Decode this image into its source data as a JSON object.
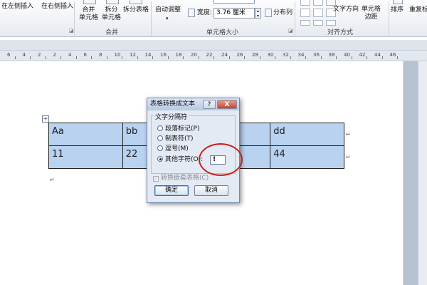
{
  "ribbon": {
    "insert_left": "在左侧插入",
    "insert_right": "在右侧插入",
    "merge_cells": [
      "合并",
      "单元格"
    ],
    "split_cells": [
      "拆分",
      "单元格"
    ],
    "split_table": "拆分表格",
    "auto_fit": "自动调整",
    "width_label": "宽度:",
    "width_value": "3.76 厘米",
    "distribute_columns": "分布列",
    "text_direction": "文字方向",
    "cell_margins": [
      "单元格",
      "边距"
    ],
    "sort": "排序",
    "repeat_header": "重复标",
    "group_merge": "合并",
    "group_cell_size": "单元格大小",
    "group_alignment": "对齐方式"
  },
  "ruler": {
    "numbers": [
      "6",
      "4",
      "2",
      "2",
      "4",
      "6",
      "8",
      "10",
      "12",
      "14",
      "16",
      "18",
      "20",
      "22",
      "24",
      "26",
      "28",
      "30",
      "32",
      "34",
      "36",
      "38",
      "40",
      "42",
      "44",
      "46"
    ]
  },
  "document": {
    "table_rows": [
      [
        "Aa",
        "bb",
        "",
        "dd"
      ],
      [
        "11",
        "22",
        "",
        "44"
      ]
    ],
    "paragraph_mark": "↵",
    "move_handle": "+"
  },
  "dialog": {
    "title": "表格转换成文本",
    "help": "?",
    "close": "X",
    "group_label": "文字分隔符",
    "options": [
      "段落标记(P)",
      "制表符(T)",
      "逗号(M)",
      "其他字符(O):"
    ],
    "selected_option": "其他字符(O):",
    "other_char": "!",
    "nested_tables": "转换嵌套表格(C)",
    "ok": "确定",
    "cancel": "取消"
  },
  "colors": {
    "table_highlight": "#b8d2f0",
    "annotation": "#c8201e"
  }
}
